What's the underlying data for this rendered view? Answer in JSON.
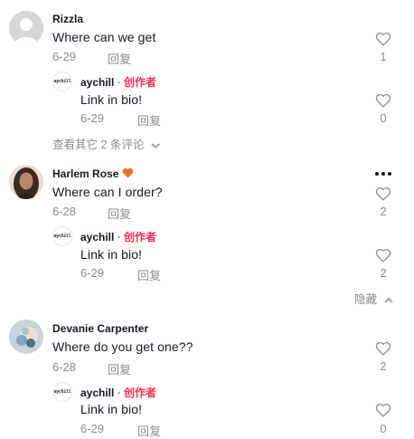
{
  "colors": {
    "creator": "#fe2c55",
    "muted": "#8a8b91",
    "text": "#161823",
    "heart_emoji": "#f26d21"
  },
  "comments": [
    {
      "username": "Rizzla",
      "text": "Where can we get",
      "date": "6-29",
      "reply_label": "回复",
      "likes": "1",
      "avatar_icon": "default-user-icon",
      "replies": [
        {
          "username": "aychill",
          "badge": "创作者",
          "text": "Link in bio!",
          "date": "6-29",
          "reply_label": "回复",
          "likes": "0"
        }
      ],
      "more_label": "查看其它 2 条评论"
    },
    {
      "username": "Harlem Rose",
      "name_emoji": "orange-heart-icon",
      "text": "Where can I order?",
      "date": "6-28",
      "reply_label": "回复",
      "likes": "2",
      "avatar_icon": "user-photo-icon",
      "replies": [
        {
          "username": "aychill",
          "badge": "创作者",
          "text": "Link in bio!",
          "date": "6-29",
          "reply_label": "回复",
          "likes": "2"
        }
      ],
      "more_label": "隐藏"
    },
    {
      "username": "Devanie Carpenter",
      "text": "Where do you get one??",
      "date": "6-28",
      "reply_label": "回复",
      "likes": "2",
      "avatar_icon": "user-photo-icon",
      "replies": [
        {
          "username": "aychill",
          "badge": "创作者",
          "text": "Link in bio!",
          "date": "6-29",
          "reply_label": "回复",
          "likes": "0"
        }
      ]
    }
  ],
  "creator_avatar_text": "aychill",
  "separator": "·"
}
